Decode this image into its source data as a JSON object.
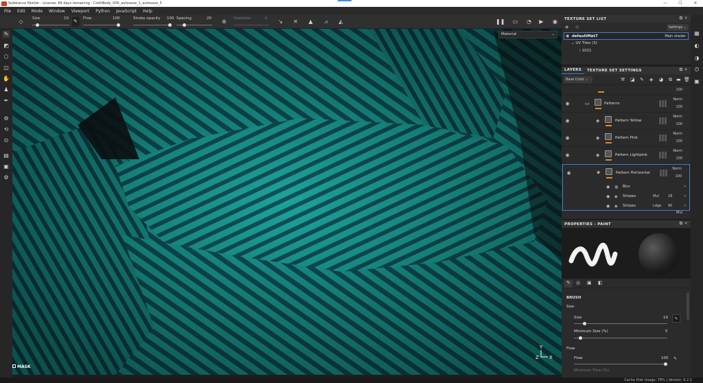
{
  "window": {
    "title": "Substance Painter - License: 66 days remaining - ClothBody_006_autosave_1_autosave_5",
    "min": "—",
    "max": "☐",
    "close": "✕"
  },
  "menu": [
    "File",
    "Edit",
    "Mode",
    "Window",
    "Viewport",
    "Python",
    "JavaScript",
    "Help"
  ],
  "toolbar": {
    "size_label": "Size",
    "size_value": "10",
    "size_pct": 0.1,
    "flow_label": "Flow",
    "flow_value": "100",
    "flow_pct": 1.0,
    "stroke_label": "Stroke opacity",
    "stroke_value": "100",
    "stroke_pct": 1.0,
    "spacing_label": "Spacing",
    "spacing_value": "20",
    "spacing_pct": 0.2,
    "stabilizer_label": "Stabilizer",
    "stabilizer_value": "0",
    "material_dropdown": "Material"
  },
  "viewport": {
    "mask_label": "MASK",
    "stripe_teal": "#1a9c95",
    "stripe_dark": "#0f4f55"
  },
  "texture_set_list": {
    "title": "TEXTURE SET LIST",
    "settings_label": "Settings",
    "material_name": "defaultMat7",
    "shader": "Main shader",
    "uv_tiles": "UV Tiles (3)",
    "tile": "1021"
  },
  "layers_panel": {
    "tab_layers": "LAYERS",
    "tab_settings": "TEXTURE SET SETTINGS",
    "channel": "Base Color",
    "top_opacity": "100",
    "layers": [
      {
        "name": "Patterns",
        "blend": "Norm",
        "opacity": "100",
        "folder": true
      },
      {
        "name": "Pattern Yellow",
        "blend": "Norm",
        "opacity": "100"
      },
      {
        "name": "Pattern Pink",
        "blend": "Norm",
        "opacity": "100"
      },
      {
        "name": "Pattern Lightpink",
        "blend": "Norm",
        "opacity": "100"
      },
      {
        "name": "Pattern Horizontal",
        "blend": "Norm",
        "opacity": "100"
      }
    ],
    "effects": [
      {
        "name": "Blur",
        "blend": "",
        "value": ""
      },
      {
        "name": "Stripes",
        "blend": "Mul",
        "value": "18"
      },
      {
        "name": "Stripes",
        "blend": "Ldge",
        "value": "90"
      }
    ],
    "next_blend": "Mul"
  },
  "properties": {
    "title": "PROPERTIES - PAINT",
    "section_brush": "BRUSH",
    "size_group": "Size",
    "size_label": "Size",
    "size_value": "10",
    "size_pct": 0.1,
    "min_size_label": "Minimum Size (%)",
    "min_size_value": "5",
    "min_size_pct": 0.05,
    "flow_group": "Flow",
    "flow_label": "Flow",
    "flow_value": "100",
    "flow_pct": 1.0,
    "min_flow_label": "Minimum Flow (%)"
  },
  "status": {
    "text": "Cache Disk Usage: 78% | Version: 6.2.2"
  }
}
